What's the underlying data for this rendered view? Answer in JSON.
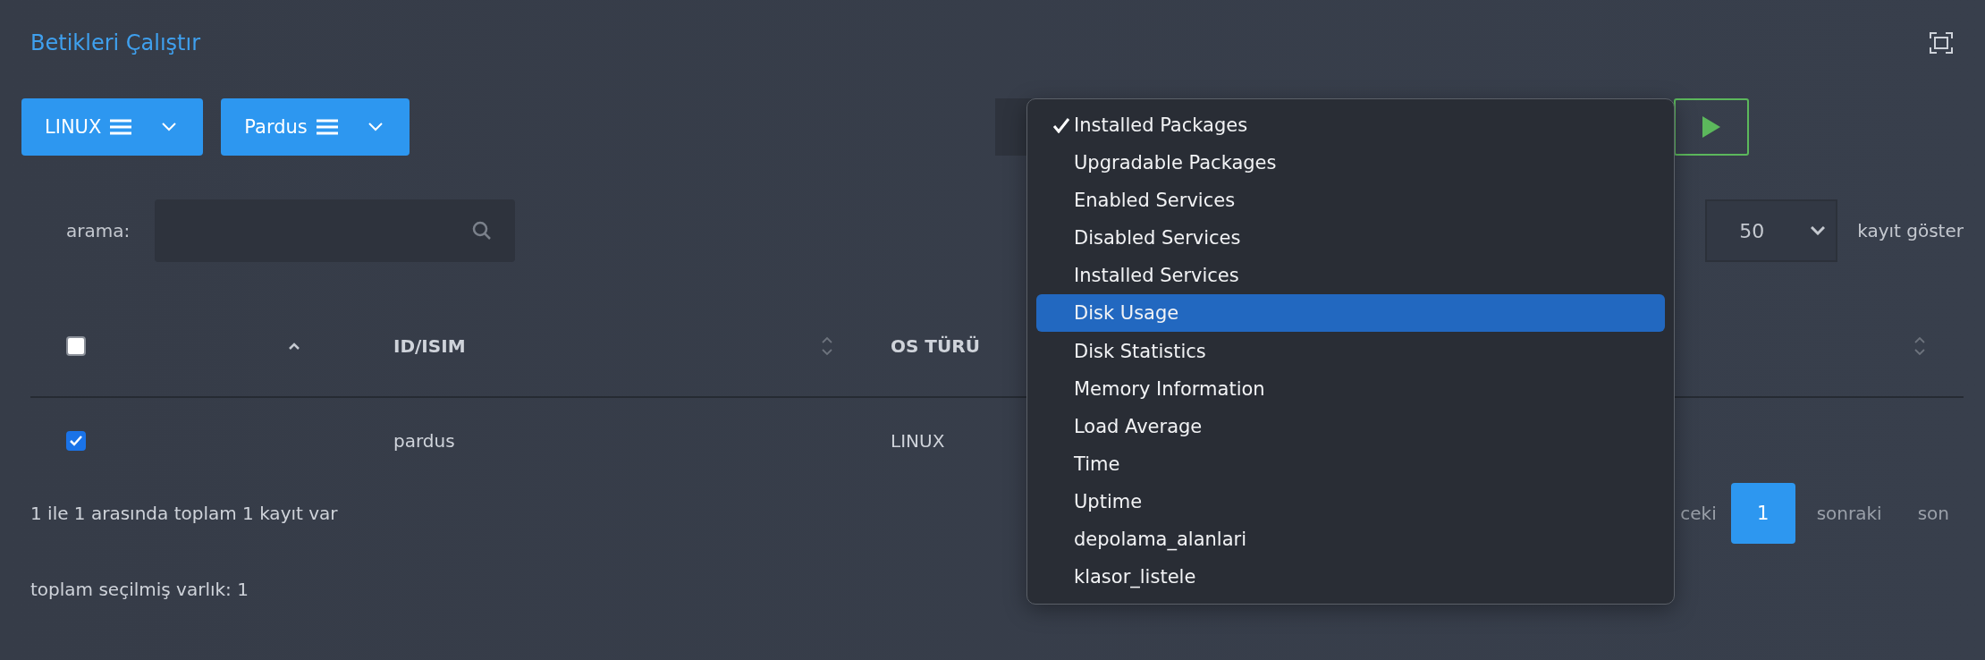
{
  "title": "Betikleri Çalıştır",
  "filters": [
    {
      "label": "LINUX"
    },
    {
      "label": "Pardus"
    }
  ],
  "search": {
    "label": "arama:"
  },
  "page_length": {
    "value": "50",
    "label": "kayıt göster"
  },
  "table": {
    "select_all": {
      "checked": false,
      "sort_active": true
    },
    "columns": [
      {
        "label": "ID/ISIM",
        "sort_active": false
      },
      {
        "label": "OS TÜRÜ",
        "sort_active": false
      }
    ],
    "rows": [
      {
        "selected": true,
        "cells": [
          "pardus",
          "LINUX"
        ]
      }
    ]
  },
  "info": "1 ile 1 arasında toplam 1 kayıt var",
  "pagination": [
    {
      "label": "ceki",
      "kind": "link",
      "selected": false
    },
    {
      "label": "1",
      "kind": "page",
      "selected": true
    },
    {
      "label": "sonraki",
      "kind": "link",
      "selected": false
    },
    {
      "label": "son",
      "kind": "link",
      "selected": false
    }
  ],
  "selected_total": "toplam seçilmiş varlık: 1",
  "script_menu": {
    "items": [
      {
        "label": "Installed Packages",
        "selected": true,
        "highlighted": false
      },
      {
        "label": "Upgradable Packages",
        "selected": false,
        "highlighted": false
      },
      {
        "label": "Enabled Services",
        "selected": false,
        "highlighted": false
      },
      {
        "label": "Disabled Services",
        "selected": false,
        "highlighted": false
      },
      {
        "label": "Installed Services",
        "selected": false,
        "highlighted": false
      },
      {
        "label": "Disk Usage",
        "selected": false,
        "highlighted": true
      },
      {
        "label": "Disk Statistics",
        "selected": false,
        "highlighted": false
      },
      {
        "label": "Memory Information",
        "selected": false,
        "highlighted": false
      },
      {
        "label": "Load Average",
        "selected": false,
        "highlighted": false
      },
      {
        "label": "Time",
        "selected": false,
        "highlighted": false
      },
      {
        "label": "Uptime",
        "selected": false,
        "highlighted": false
      },
      {
        "label": "depolama_alanlari",
        "selected": false,
        "highlighted": false
      },
      {
        "label": "klasor_listele",
        "selected": false,
        "highlighted": false
      }
    ]
  }
}
